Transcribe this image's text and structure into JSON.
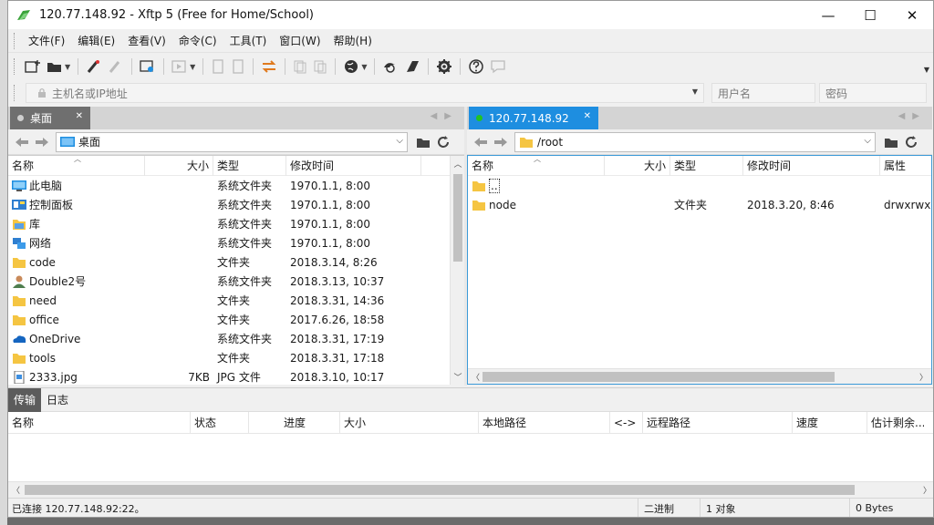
{
  "window": {
    "title": "120.77.148.92   - Xftp 5 (Free for Home/School)",
    "controls": {
      "minimize": "—",
      "maximize": "☐",
      "close": "✕"
    }
  },
  "menu": [
    "文件(F)",
    "编辑(E)",
    "查看(V)",
    "命令(C)",
    "工具(T)",
    "窗口(W)",
    "帮助(H)"
  ],
  "address": {
    "host_placeholder": "主机名或IP地址",
    "user_placeholder": "用户名",
    "password_placeholder": "密码"
  },
  "left_pane": {
    "tab_label": "桌面",
    "path": "桌面",
    "columns": [
      "名称",
      "大小",
      "类型",
      "修改时间"
    ],
    "rows": [
      {
        "name": "此电脑",
        "size": "",
        "type": "系统文件夹",
        "modified": "1970.1.1, 8:00",
        "icon": "computer-icon"
      },
      {
        "name": "控制面板",
        "size": "",
        "type": "系统文件夹",
        "modified": "1970.1.1, 8:00",
        "icon": "control-panel-icon"
      },
      {
        "name": "库",
        "size": "",
        "type": "系统文件夹",
        "modified": "1970.1.1, 8:00",
        "icon": "library-icon"
      },
      {
        "name": "网络",
        "size": "",
        "type": "系统文件夹",
        "modified": "1970.1.1, 8:00",
        "icon": "network-icon"
      },
      {
        "name": "code",
        "size": "",
        "type": "文件夹",
        "modified": "2018.3.14, 8:26",
        "icon": "folder-icon"
      },
      {
        "name": "Double2号",
        "size": "",
        "type": "系统文件夹",
        "modified": "2018.3.13, 10:37",
        "icon": "user-icon"
      },
      {
        "name": "need",
        "size": "",
        "type": "文件夹",
        "modified": "2018.3.31, 14:36",
        "icon": "folder-icon"
      },
      {
        "name": "office",
        "size": "",
        "type": "文件夹",
        "modified": "2017.6.26, 18:58",
        "icon": "folder-icon"
      },
      {
        "name": "OneDrive",
        "size": "",
        "type": "系统文件夹",
        "modified": "2018.3.31, 17:19",
        "icon": "onedrive-icon"
      },
      {
        "name": "tools",
        "size": "",
        "type": "文件夹",
        "modified": "2018.3.31, 17:18",
        "icon": "folder-icon"
      },
      {
        "name": "2333.jpg",
        "size": "7KB",
        "type": "JPG 文件",
        "modified": "2018.3.10, 10:17",
        "icon": "image-file-icon"
      }
    ]
  },
  "right_pane": {
    "tab_label": "120.77.148.92",
    "path": "/root",
    "columns": [
      "名称",
      "大小",
      "类型",
      "修改时间",
      "属性"
    ],
    "rows": [
      {
        "name": "..",
        "size": "",
        "type": "",
        "modified": "",
        "attr": "",
        "icon": "folder-icon"
      },
      {
        "name": "node",
        "size": "",
        "type": "文件夹",
        "modified": "2018.3.20, 8:46",
        "attr": "drwxrwxr",
        "icon": "folder-icon"
      }
    ]
  },
  "transfer": {
    "tabs": [
      "传输",
      "日志"
    ],
    "columns": [
      "名称",
      "状态",
      "进度",
      "大小",
      "本地路径",
      "<->",
      "远程路径",
      "速度",
      "估计剩余..."
    ]
  },
  "status": {
    "connection": "已连接 120.77.148.92:22。",
    "mode": "二进制",
    "objects": "1 对象",
    "bytes": "0 Bytes"
  },
  "colors": {
    "accent": "#1e8ee0",
    "folder": "#f5c542",
    "connected_dot": "#22c322"
  }
}
